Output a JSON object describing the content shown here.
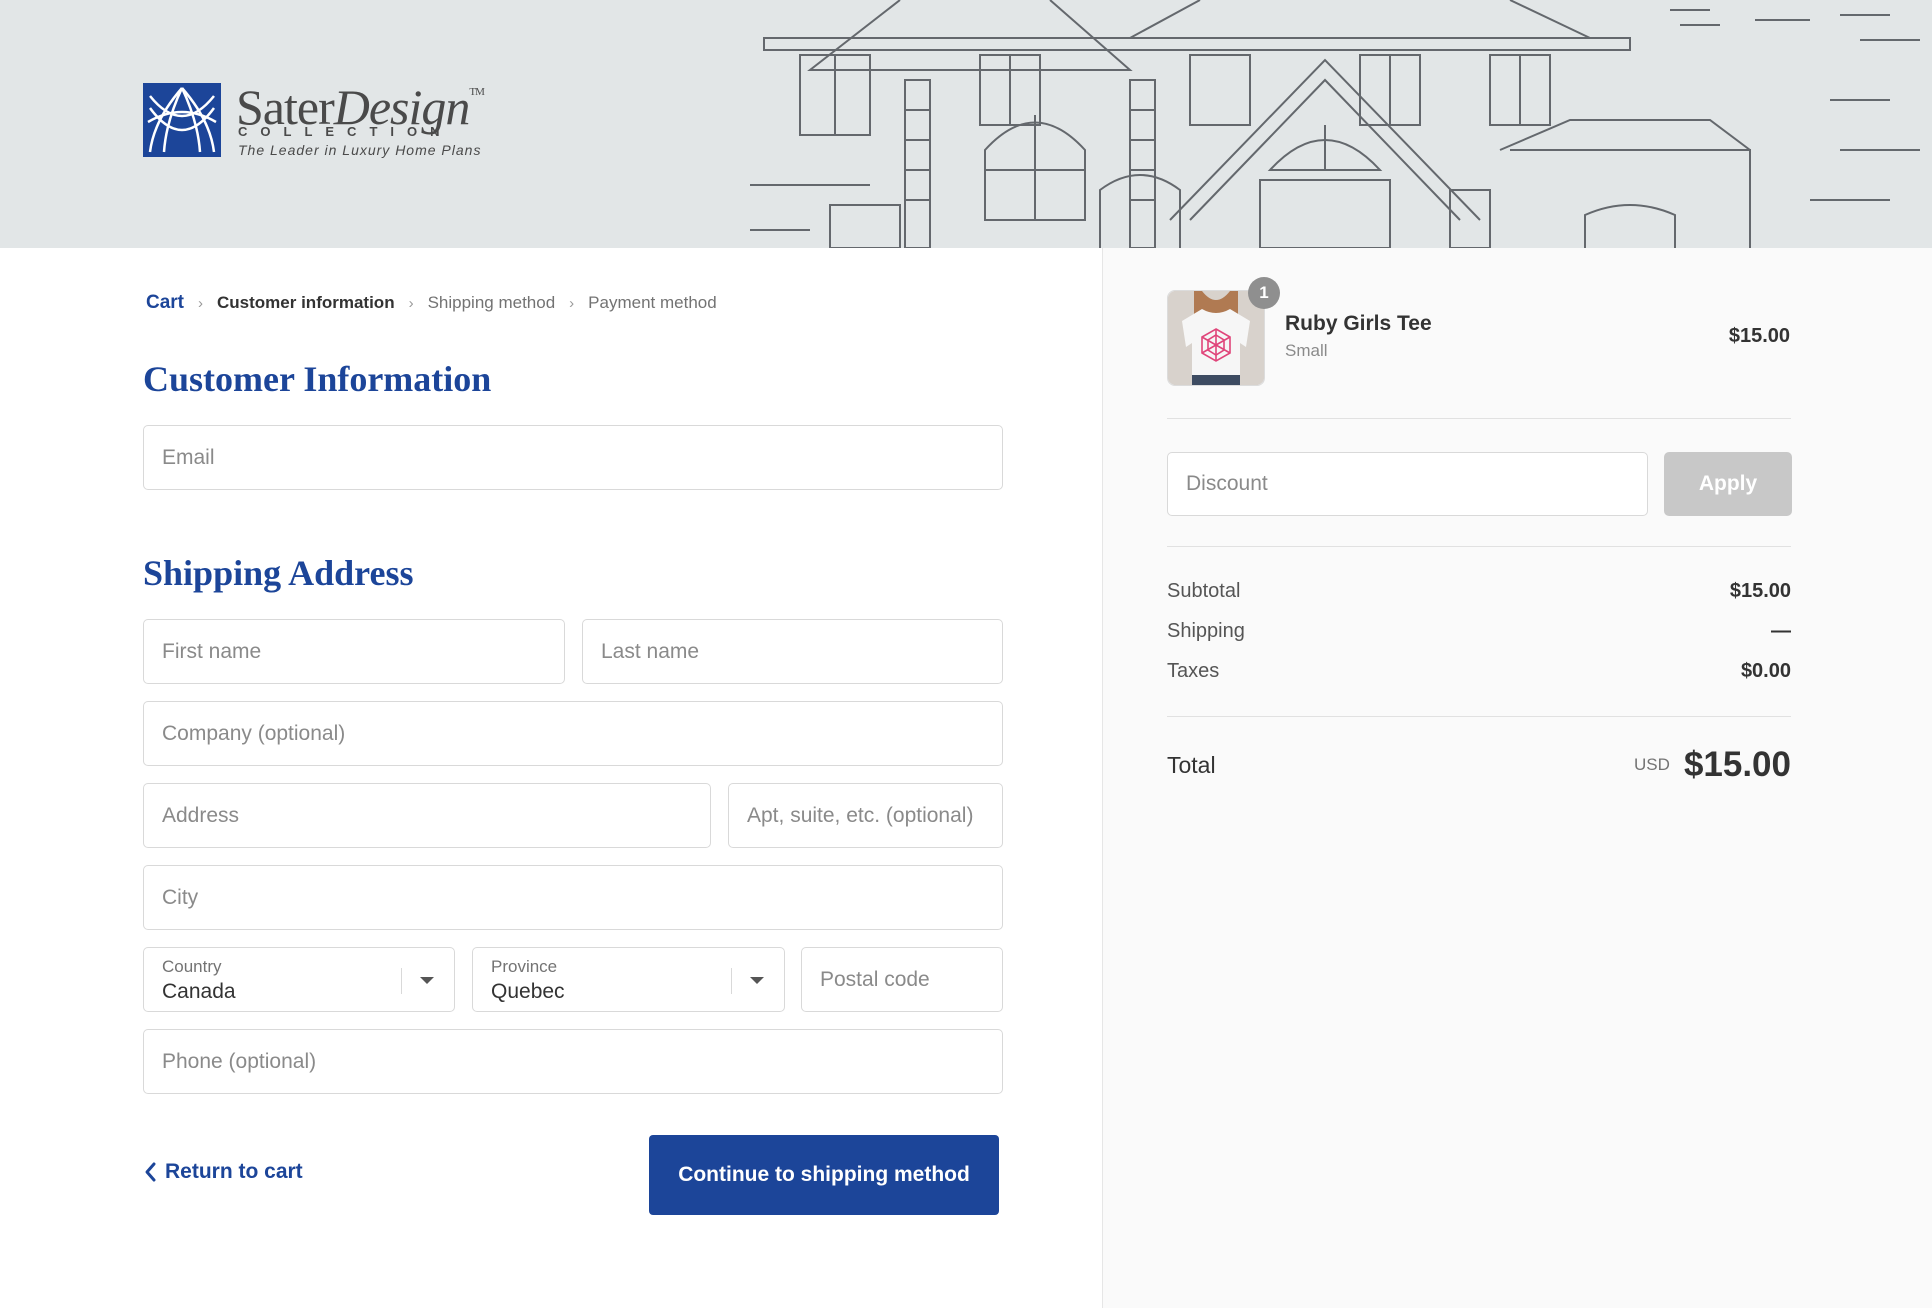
{
  "brand": {
    "name_plain": "Sater",
    "name_script": "Design",
    "trademark": "TM",
    "collection": "COLLECTION",
    "tagline": "The Leader in Luxury Home Plans"
  },
  "breadcrumb": {
    "items": [
      {
        "label": "Cart"
      },
      {
        "label": "Customer information"
      },
      {
        "label": "Shipping method"
      },
      {
        "label": "Payment method"
      }
    ],
    "separator": "›"
  },
  "customer": {
    "title": "Customer Information",
    "email_placeholder": "Email"
  },
  "shipping": {
    "title": "Shipping Address",
    "first_name_placeholder": "First name",
    "last_name_placeholder": "Last name",
    "company_placeholder": "Company (optional)",
    "address_placeholder": "Address",
    "apt_placeholder": "Apt, suite, etc. (optional)",
    "city_placeholder": "City",
    "country_label": "Country",
    "country_value": "Canada",
    "province_label": "Province",
    "province_value": "Quebec",
    "postal_placeholder": "Postal code",
    "phone_placeholder": "Phone (optional)"
  },
  "actions": {
    "return_label": "Return to cart",
    "continue_label": "Continue to shipping method"
  },
  "order": {
    "item": {
      "quantity": "1",
      "name": "Ruby Girls Tee",
      "variant": "Small",
      "price": "$15.00"
    },
    "discount_placeholder": "Discount",
    "apply_label": "Apply",
    "subtotal_label": "Subtotal",
    "subtotal_value": "$15.00",
    "shipping_label": "Shipping",
    "shipping_value": "—",
    "taxes_label": "Taxes",
    "taxes_value": "$0.00",
    "total_label": "Total",
    "total_currency": "USD",
    "total_value": "$15.00"
  },
  "colors": {
    "brand_blue": "#1c4599",
    "apply_disabled": "#c8c8c8",
    "banner_bg": "#e2e6e7"
  }
}
